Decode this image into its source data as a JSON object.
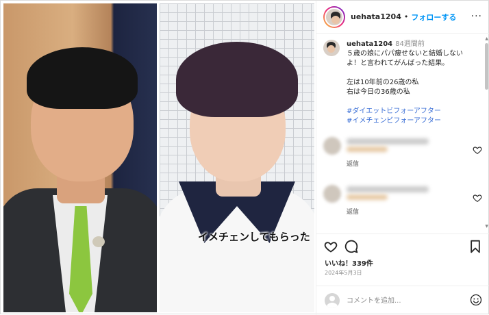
{
  "media": {
    "caption": "イメチェンしてもらった"
  },
  "header": {
    "username": "uehata1204",
    "separator": "•",
    "follow_label": "フォローする",
    "more_label": "···"
  },
  "post": {
    "username": "uehata1204",
    "time_ago": "84週間前",
    "lines": [
      "５歳の娘にパパ痩せないと結婚しない",
      "よ！と言われてがんばった結果。",
      "左は10年前の26歳の私",
      "右は今日の36歳の私"
    ],
    "hashtags": [
      "#ダイエットビフォーアフター",
      "#イメチェンビフォーアフター"
    ]
  },
  "comments": [
    {
      "reply_label": "返信"
    },
    {
      "reply_label": "返信"
    }
  ],
  "actions": {
    "like_count_text": "いいね！339件",
    "date": "2024年5月3日"
  },
  "comment_bar": {
    "placeholder": "コメントを追加..."
  },
  "icons": {
    "like": "heart-icon",
    "comment": "comment-bubble-icon",
    "save": "bookmark-icon",
    "emoji": "smiley-icon",
    "more": "more-dots-icon"
  },
  "colors": {
    "follow": "#0095f6",
    "hashtag": "#3b6fd6",
    "muted": "#8e8e8e",
    "tie": "#8cc63f"
  }
}
